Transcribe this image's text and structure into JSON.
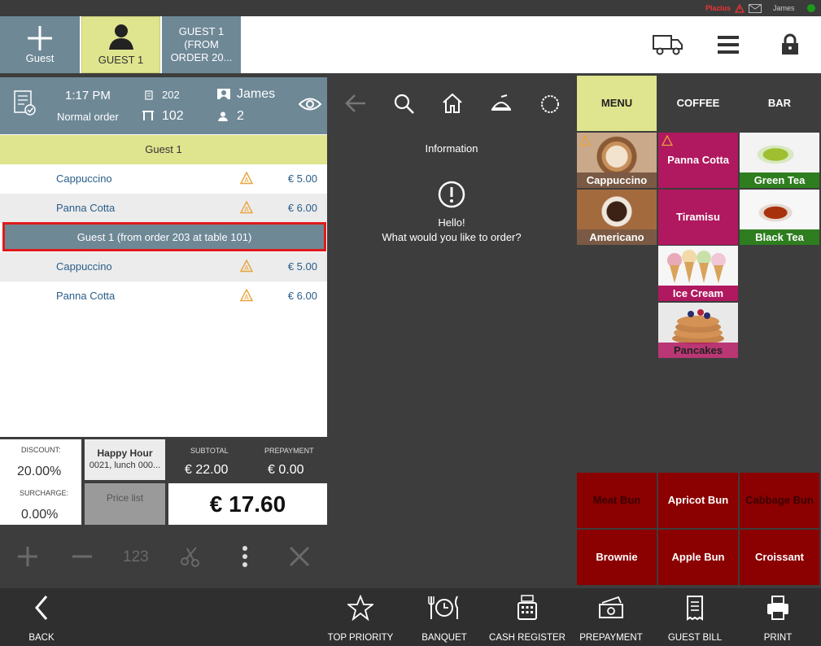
{
  "sysbar": {
    "brand": "Plazius",
    "user": "James"
  },
  "tabs": {
    "add_guest": "Guest",
    "guest1": "GUEST 1",
    "guest1_from": "GUEST 1\n(FROM\nORDER 20..."
  },
  "order_header": {
    "time": "1:17 PM",
    "order_type": "Normal order",
    "order_no": "202",
    "table_no": "102",
    "waiter": "James",
    "guests": "2"
  },
  "order_list": {
    "group1": "Guest 1",
    "items1": [
      {
        "name": "Cappuccino",
        "price": "€ 5.00"
      },
      {
        "name": "Panna Cotta",
        "price": "€ 6.00"
      }
    ],
    "group2": "Guest 1 (from order 203 at table 101)",
    "items2": [
      {
        "name": "Cappuccino",
        "price": "€ 5.00"
      },
      {
        "name": "Panna Cotta",
        "price": "€ 6.00"
      }
    ]
  },
  "summary": {
    "discount_label": "DISCOUNT:",
    "discount": "20.00%",
    "surcharge_label": "SURCHARGE:",
    "surcharge": "0.00%",
    "happy_hour_title": "Happy Hour",
    "happy_hour_sub": "0021, lunch 000...",
    "price_list": "Price list",
    "subtotal_label": "SUBTOTAL",
    "subtotal": "€ 22.00",
    "prepayment_label": "PREPAYMENT",
    "prepayment": "€ 0.00",
    "total": "€ 17.60"
  },
  "actions": {
    "qty": "123"
  },
  "info": {
    "title": "Information",
    "hello": "Hello!",
    "question": "What would you like to order?"
  },
  "categories": {
    "menu": "MENU",
    "coffee": "COFFEE",
    "bar": "BAR"
  },
  "menu_tiles": {
    "cappuccino": "Cappuccino",
    "panna_cotta": "Panna Cotta",
    "green_tea": "Green Tea",
    "americano": "Americano",
    "tiramisu": "Tiramisu",
    "black_tea": "Black Tea",
    "ice_cream": "Ice Cream",
    "pancakes": "Pancakes"
  },
  "quick_tiles": [
    "Meat Bun",
    "Apricot Bun",
    "Cabbage Bun",
    "Brownie",
    "Apple Bun",
    "Croissant"
  ],
  "bottom": {
    "back": "BACK",
    "top_priority": "TOP PRIORITY",
    "banquet": "BANQUET",
    "cash_register": "CASH REGISTER",
    "prepayment": "PREPAYMENT",
    "guest_bill": "GUEST BILL",
    "print": "PRINT"
  },
  "colors": {
    "accent": "#dfe48e",
    "header": "#6e8896",
    "magenta": "#b0185f",
    "dark_red": "#8b0000",
    "green_label": "#2e7d1e"
  }
}
